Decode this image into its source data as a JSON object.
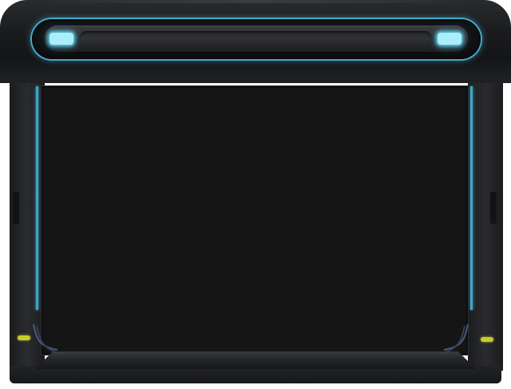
{
  "app": {
    "title": "",
    "accent_color": "#46a9c8",
    "lamp_color": "#a9eefa",
    "indicator_color": "#c8cc2a",
    "screen_color": "#151515"
  },
  "viewport": {
    "content": ""
  }
}
